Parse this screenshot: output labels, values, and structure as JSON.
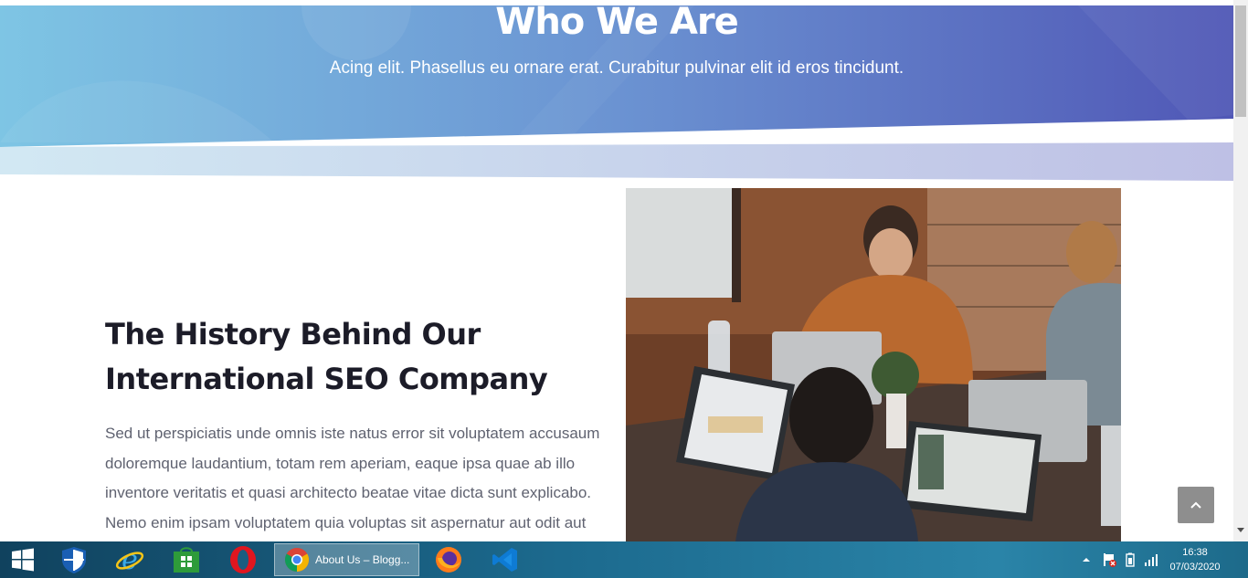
{
  "hero": {
    "title": "Who We Are",
    "subtitle": "Acing elit. Phasellus eu ornare erat. Curabitur pulvinar elit id eros tincidunt."
  },
  "history": {
    "title_line1": "The History Behind Our",
    "title_line2": "International SEO Company",
    "body_lines": [
      "Sed ut perspiciatis unde omnis iste natus error sit voluptatem accusaum",
      "doloremque laudantium, totam rem aperiam, eaque ipsa quae ab illo",
      "inventore veritatis et quasi architecto beatae vitae dicta sunt explicabo.",
      "Nemo enim ipsam voluptatem quia voluptas sit aspernatur aut odit aut"
    ]
  },
  "photo": {
    "icon": "team-photo-image"
  },
  "scroll_top": {
    "icon": "chevron-up-icon"
  },
  "taskbar": {
    "active_window_label": "About Us – Blogg...",
    "apps": [
      "start-icon",
      "defender-icon",
      "internet-explorer-icon",
      "store-icon",
      "opera-icon",
      "chrome-icon",
      "firefox-icon",
      "vscode-icon"
    ],
    "clock_time": "16:38",
    "clock_date": "07/03/2020"
  },
  "colors": {
    "hero_left": "#7ec3e3",
    "hero_right": "#5258b8",
    "heading": "#1c1c28",
    "body_text": "#5f6270",
    "scroll_top_bg": "#8e8e8e"
  }
}
